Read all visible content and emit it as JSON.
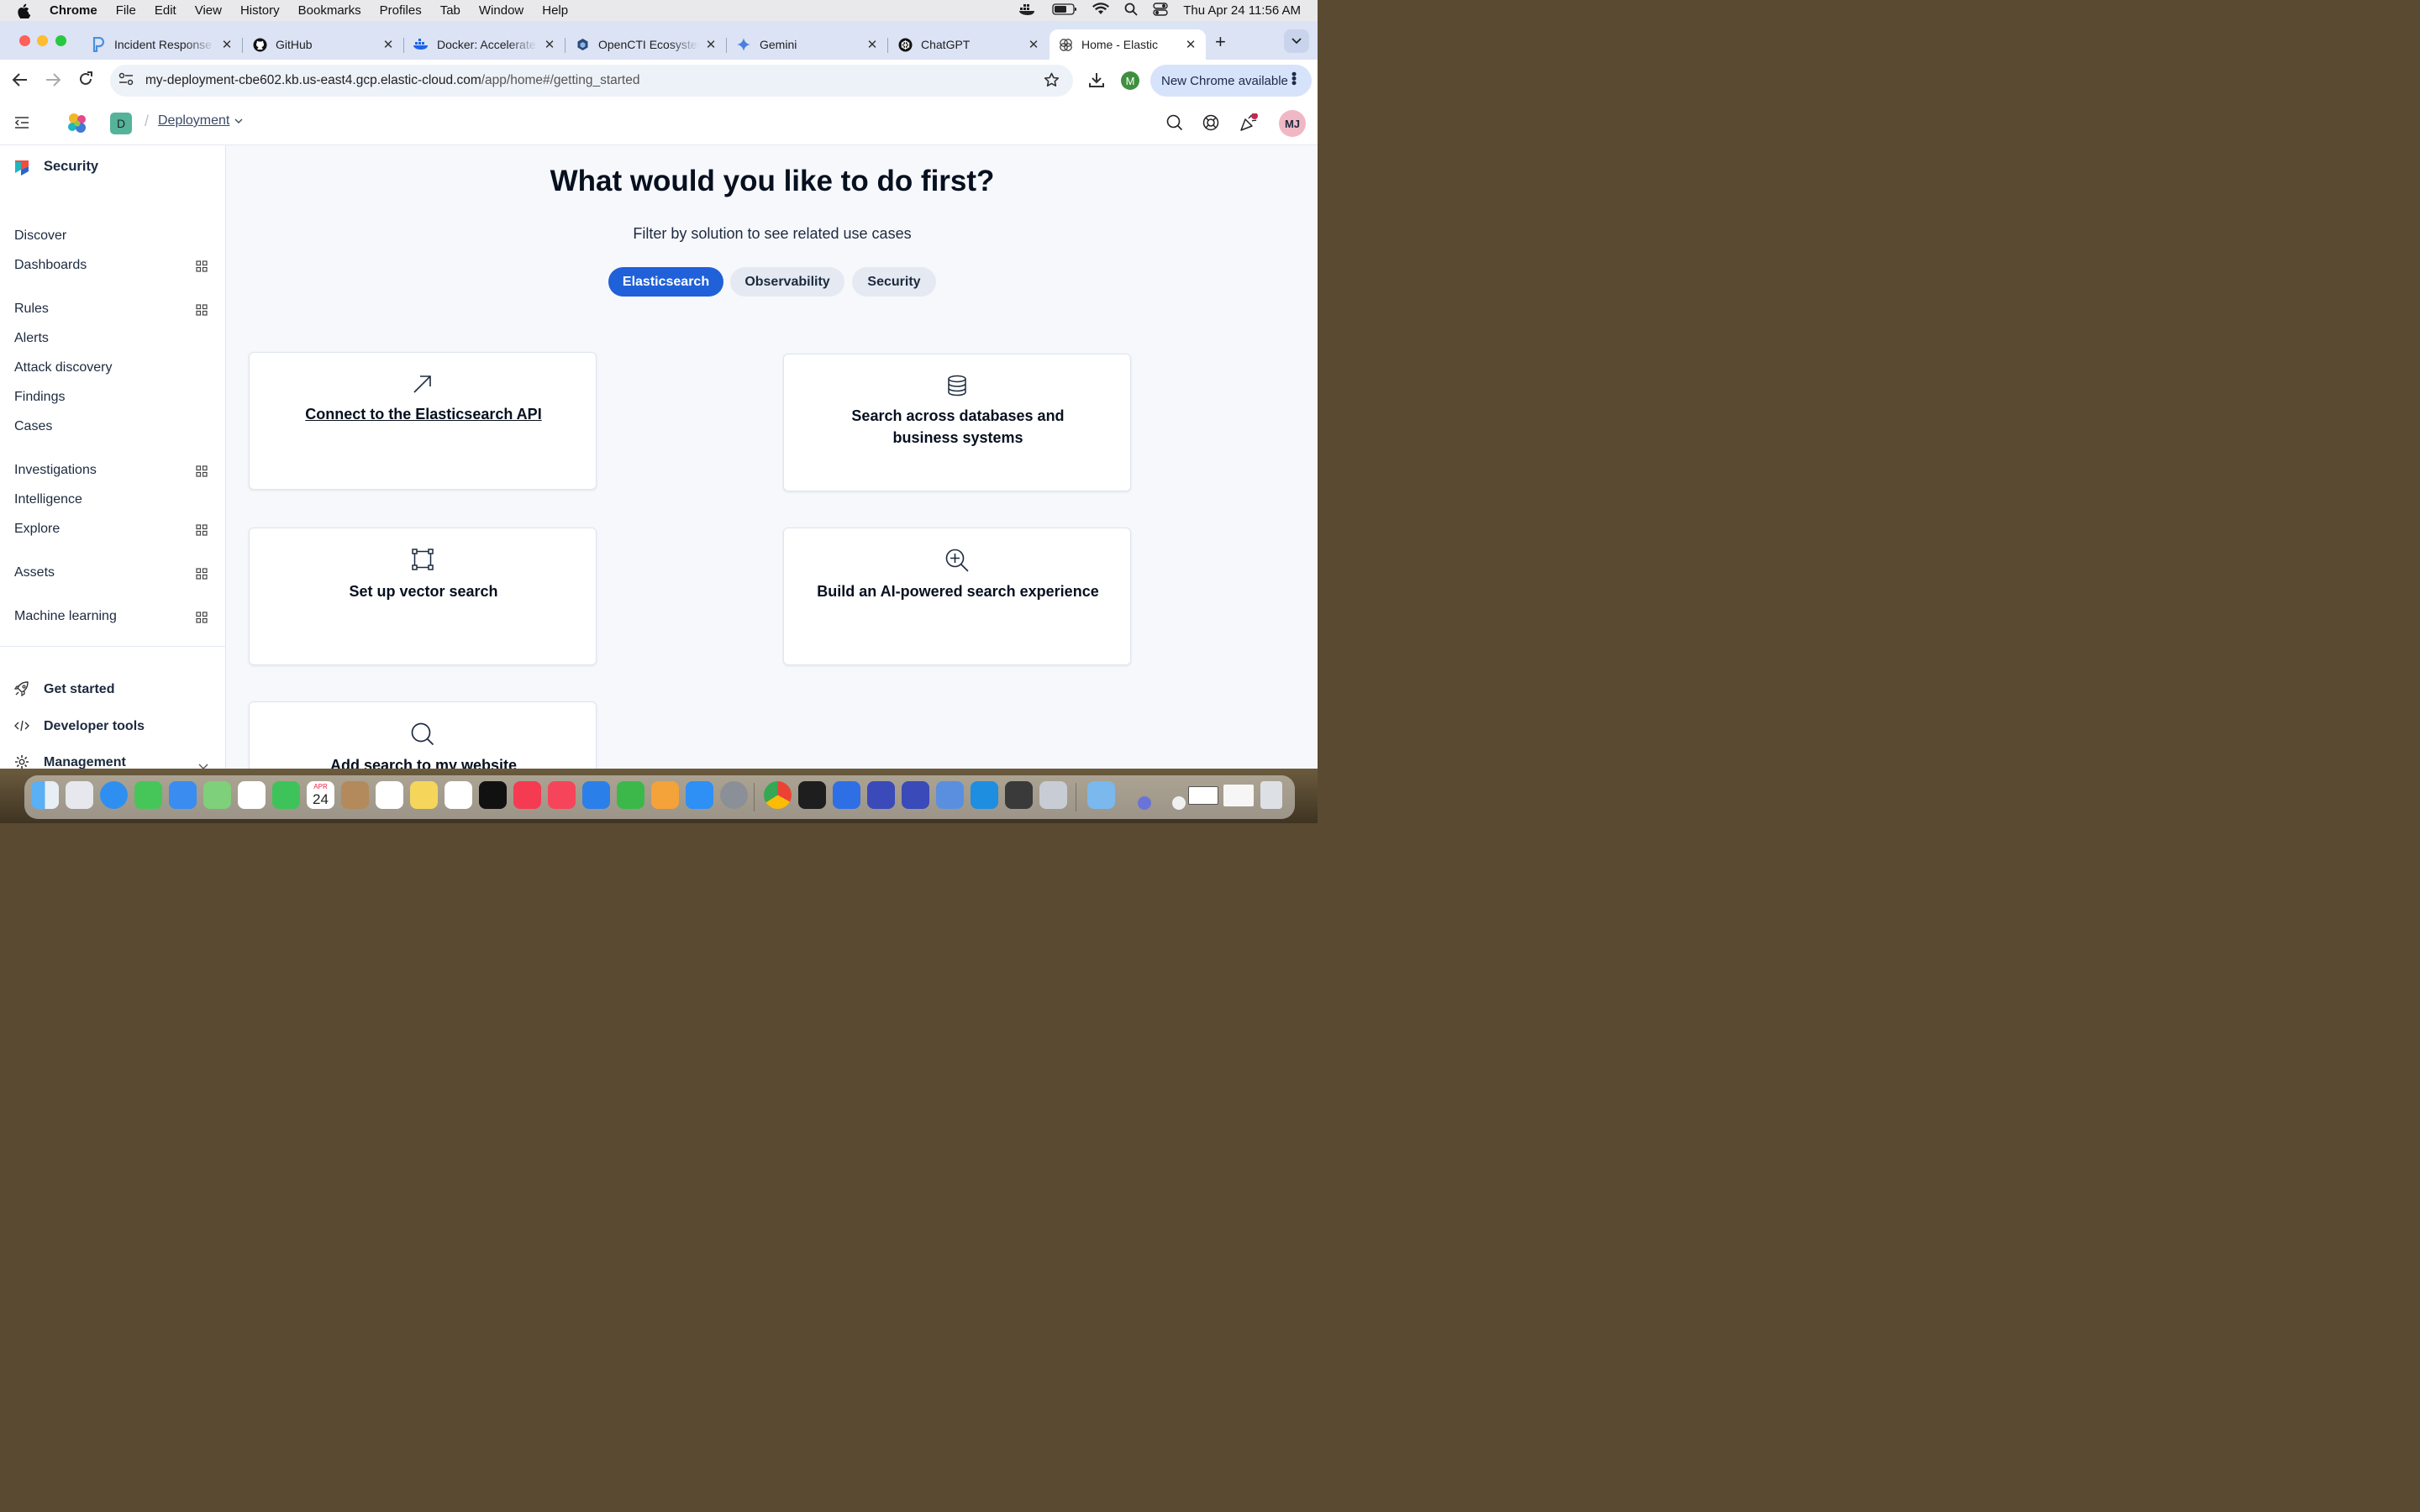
{
  "menubar": {
    "app_name": "Chrome",
    "items": [
      "File",
      "Edit",
      "View",
      "History",
      "Bookmarks",
      "Profiles",
      "Tab",
      "Window",
      "Help"
    ],
    "datetime": "Thu Apr 24  11:56 AM"
  },
  "tabs": [
    {
      "title": "Incident Response",
      "icon": "pagerduty-icon"
    },
    {
      "title": "GitHub",
      "icon": "github-icon"
    },
    {
      "title": "Docker: Accelerate",
      "icon": "docker-icon"
    },
    {
      "title": "OpenCTI Ecosystem",
      "icon": "opencti-icon"
    },
    {
      "title": "Gemini",
      "icon": "gemini-icon"
    },
    {
      "title": "ChatGPT",
      "icon": "chatgpt-icon"
    },
    {
      "title": "Home - Elastic",
      "icon": "elastic-icon",
      "active": true
    }
  ],
  "address_bar": {
    "domain": "my-deployment-cbe602.kb.us-east4.gcp.elastic-cloud.com",
    "path": "/app/home#/getting_started"
  },
  "profile_initial": "M",
  "new_chrome_label": "New Chrome available",
  "kibana_header": {
    "deployment_badge": "D",
    "breadcrumb_separator": "/",
    "breadcrumb": "Deployment",
    "avatar_initials": "MJ"
  },
  "sidebar": {
    "title": "Security",
    "items": [
      {
        "label": "Discover",
        "has_panel": false
      },
      {
        "label": "Dashboards",
        "has_panel": true
      },
      {
        "label": "Rules",
        "has_panel": true
      },
      {
        "label": "Alerts",
        "has_panel": false
      },
      {
        "label": "Attack discovery",
        "has_panel": false
      },
      {
        "label": "Findings",
        "has_panel": false
      },
      {
        "label": "Cases",
        "has_panel": false
      },
      {
        "label": "Investigations",
        "has_panel": true
      },
      {
        "label": "Intelligence",
        "has_panel": false
      },
      {
        "label": "Explore",
        "has_panel": true
      },
      {
        "label": "Assets",
        "has_panel": true
      },
      {
        "label": "Machine learning",
        "has_panel": true
      }
    ],
    "footer": {
      "get_started": "Get started",
      "developer_tools": "Developer tools",
      "management": "Management"
    }
  },
  "main": {
    "heading": "What would you like to do first?",
    "subheading": "Filter by solution to see related use cases",
    "filters": [
      {
        "label": "Elasticsearch",
        "selected": true
      },
      {
        "label": "Observability",
        "selected": false
      },
      {
        "label": "Security",
        "selected": false
      }
    ],
    "cards": [
      {
        "title": "Connect to the Elasticsearch API",
        "icon": "arrow-up-right-icon",
        "is_link": true
      },
      {
        "title": "Search across databases and business systems",
        "icon": "database-icon",
        "is_link": false
      },
      {
        "title": "Set up vector search",
        "icon": "vector-icon",
        "is_link": false
      },
      {
        "title": "Build an AI-powered search experience",
        "icon": "magnify-plus-icon",
        "is_link": false
      },
      {
        "title": "Add search to my website",
        "icon": "search-icon",
        "is_link": false
      }
    ]
  },
  "dock": {
    "date_month": "APR",
    "date_day": "24"
  },
  "colors": {
    "primary": "#2060d8",
    "pill_inactive": "#e5e9f2",
    "tabstrip": "#dbe3f5"
  }
}
